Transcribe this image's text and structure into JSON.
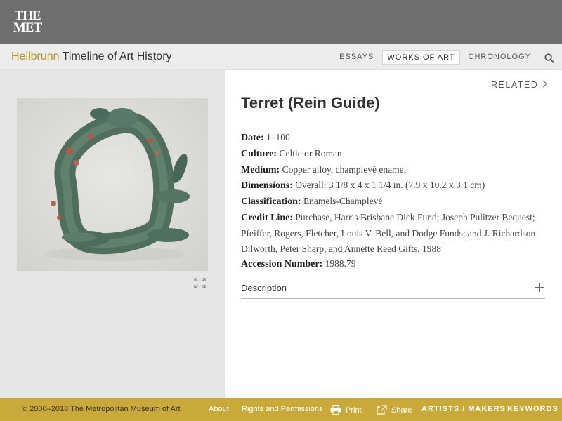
{
  "logo": {
    "line1": "THE",
    "line2": "MET"
  },
  "brand": {
    "accent": "Heilbrunn",
    "rest": " Timeline of Art History"
  },
  "nav": [
    {
      "label": "ESSAYS"
    },
    {
      "label": "WORKS OF ART",
      "active": true
    },
    {
      "label": "CHRONOLOGY"
    }
  ],
  "related": {
    "label": "RELATED"
  },
  "artwork": {
    "title": "Terret (Rein Guide)"
  },
  "meta": [
    {
      "label": "Date:",
      "value": " 1–100"
    },
    {
      "label": "Culture:",
      "value": " Celtic or Roman"
    },
    {
      "label": "Medium:",
      "value": " Copper alloy, champlevé enamel"
    },
    {
      "label": "Dimensions:",
      "value": " Overall: 3 1/8 x 4 x 1 1/4 in. (7.9 x 10.2 x 3.1 cm)"
    },
    {
      "label": "Classification:",
      "value": " Enamels-Champlevé"
    },
    {
      "label": "Credit Line:",
      "value": " Purchase, Harris Brisbane Dick Fund; Joseph Pulitzer Bequest; Pfeiffer, Rogers, Fletcher, Louis V. Bell, and Dodge Funds; and J. Richardson Dilworth, Peter Sharp, and Annette Reed Gifts, 1988"
    },
    {
      "label": "Accession Number:",
      "value": " 1988.79"
    }
  ],
  "description": {
    "label": "Description"
  },
  "footer": {
    "copyright": "© 2000–2018 The Metropolitan Museum of Art",
    "about": "About",
    "rights": "Rights and Permissions",
    "print": "Print",
    "share": "Share",
    "artists": "ARTISTS / MAKERS",
    "keywords": "KEYWORDS"
  },
  "colors": {
    "topbar": "#6f6f6f",
    "accent": "#b69513",
    "footer": "#c8a93a",
    "panel": "#e5e5e5"
  },
  "icons": {
    "search": "search-icon",
    "expand": "expand-icon",
    "related": "chevron-right-icon",
    "description": "plus-icon",
    "print": "printer-icon",
    "share": "share-icon"
  }
}
